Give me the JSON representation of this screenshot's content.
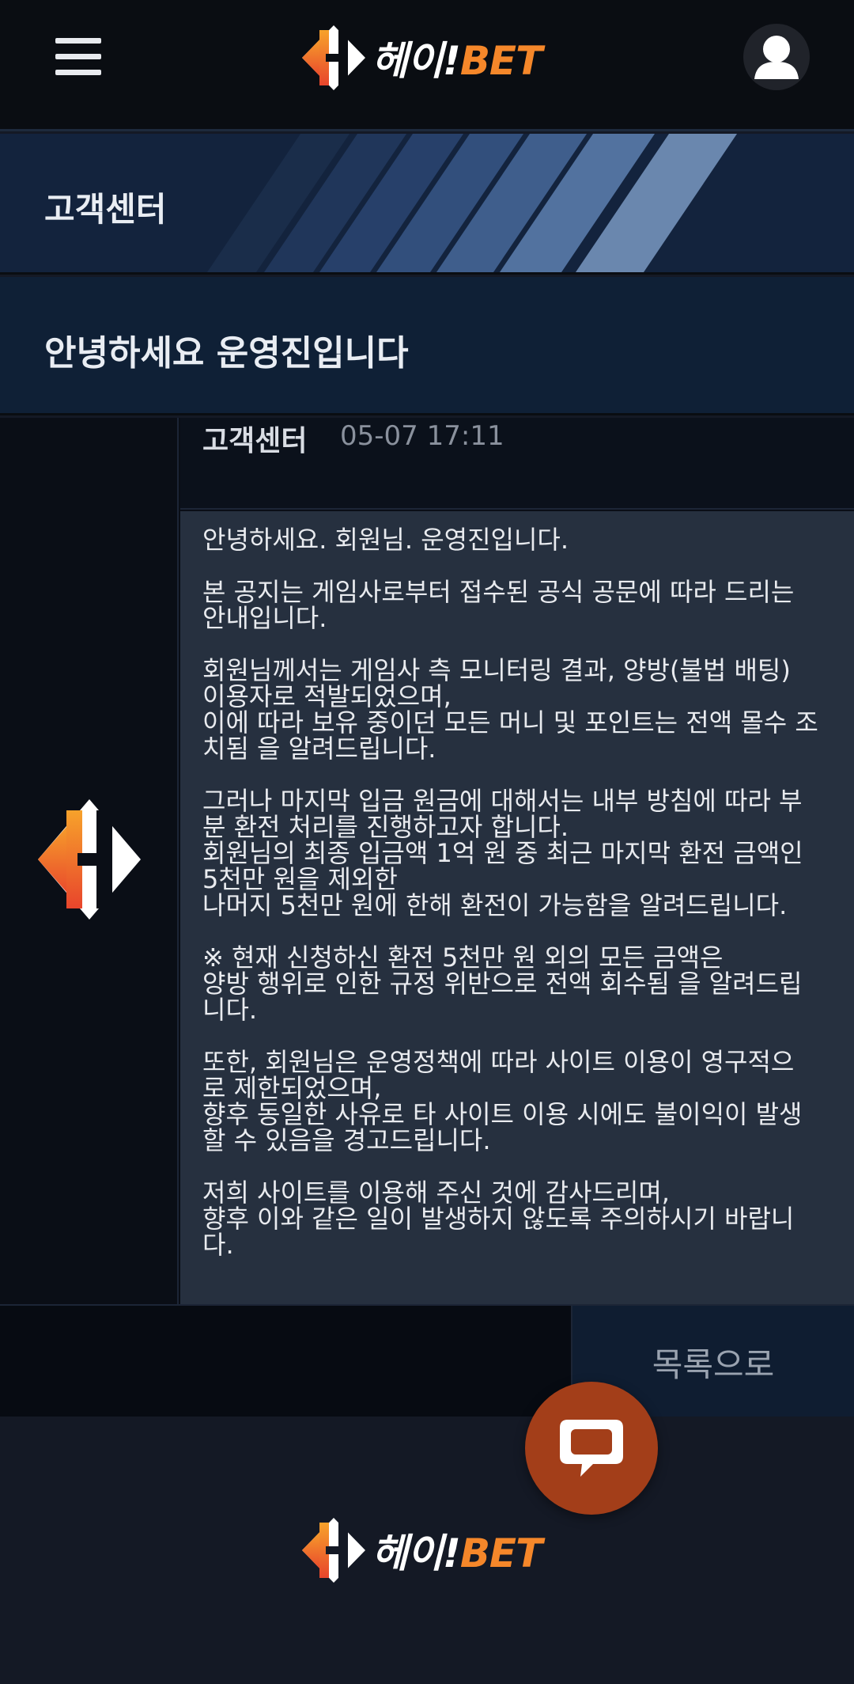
{
  "header": {
    "logo": {
      "text_main": "헤이!",
      "text_accent": "BET"
    },
    "menu_icon": "hamburger-menu-icon",
    "profile_icon": "user-avatar-icon"
  },
  "banner": {
    "title": "고객센터"
  },
  "post": {
    "subject": "안녕하세요 운영진입니다",
    "author": "고객센터",
    "date": "05-07 17:11",
    "paragraphs": [
      "안녕하세요. 회원님. 운영진입니다.",
      "본 공지는 게임사로부터 접수된 공식 공문에 따라 드리는\n안내입니다.",
      "회원님께서는 게임사 측 모니터링 결과, 양방(불법 배팅)\n이용자로 적발되었으며,\n이에 따라 보유 중이던 모든 머니 및 포인트는 전액 몰수 조\n치됨 을 알려드립니다.",
      "그러나 마지막 입금 원금에 대해서는 내부 방침에 따라 부\n분 환전 처리를 진행하고자 합니다.\n회원님의 최종 입금액 1억 원 중 최근 마지막 환전 금액인\n5천만 원을 제외한\n나머지 5천만 원에 한해 환전이 가능함을 알려드립니다.",
      "※ 현재 신청하신 환전 5천만 원 외의 모든 금액은\n양방 행위로 인한 규정 위반으로 전액 회수됨 을 알려드립\n니다.",
      "또한, 회원님은 운영정책에 따라 사이트 이용이 영구적으\n로 제한되었으며,\n향후 동일한 사유로 타 사이트 이용 시에도 불이익이 발생\n할 수 있음을 경고드립니다.",
      "저희 사이트를 이용해 주신 것에 감사드리며,\n향후 이와 같은 일이 발생하지 않도록 주의하시기 바랍니\n다."
    ]
  },
  "actions": {
    "list_button": "목록으로"
  },
  "footer": {
    "logo": {
      "text_main": "헤이!",
      "text_accent": "BET"
    }
  },
  "chat": {
    "icon": "chat-bubble-icon"
  },
  "colors": {
    "brand_orange": "#f5872a",
    "brand_red": "#e8452c",
    "chat_button": "#a33e19",
    "banner_bg": "#13233d",
    "post_body_bg": "#26303f"
  }
}
